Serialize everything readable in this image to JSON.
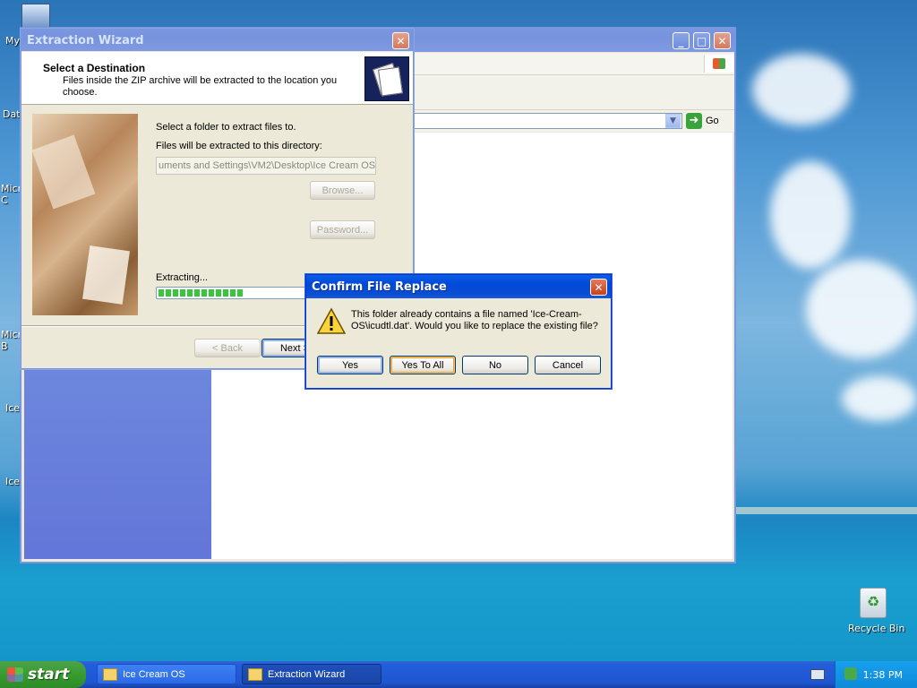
{
  "desktop": {
    "icons": [
      {
        "label": "My"
      },
      {
        "label": "Dat"
      },
      {
        "label": "Micro C"
      },
      {
        "label": "Micro B"
      },
      {
        "label": "Ice"
      },
      {
        "label": "Ice"
      }
    ],
    "recycle_bin": "Recycle Bin"
  },
  "explorer": {
    "go_label": "Go"
  },
  "wizard": {
    "title": "Extraction Wizard",
    "heading": "Select a Destination",
    "subheading": "Files inside the ZIP archive will be extracted to the location you choose.",
    "select_folder_label": "Select a folder to extract files to.",
    "directory_label": "Files will be extracted to this directory:",
    "directory_value": "uments and Settings\\VM2\\Desktop\\Ice Cream OS",
    "browse_label": "Browse...",
    "password_label": "Password...",
    "extracting_label": "Extracting...",
    "progress_fraction": 0.4,
    "back_label": "< Back",
    "next_label": "Next >"
  },
  "confirm": {
    "title": "Confirm File Replace",
    "message": "This folder already contains a file named 'Ice-Cream-OS\\icudtl.dat'.  Would you like to replace the existing file?",
    "yes_label": "Yes",
    "yes_to_all_label": "Yes To All",
    "no_label": "No",
    "cancel_label": "Cancel"
  },
  "taskbar": {
    "start_label": "start",
    "tasks": [
      {
        "label": "Ice Cream OS"
      },
      {
        "label": "Extraction Wizard"
      }
    ],
    "clock": "1:38 PM"
  }
}
